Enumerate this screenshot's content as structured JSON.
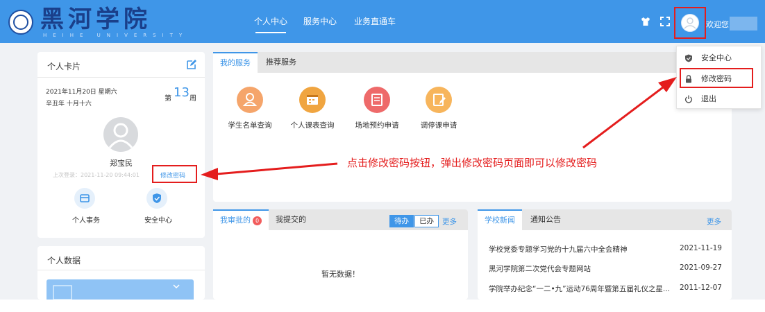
{
  "header": {
    "logo_text": "黑河学院",
    "logo_sub": "HEIHE UNIVERSITY",
    "nav": [
      "个人中心",
      "服务中心",
      "业务直通车"
    ],
    "welcome": "欢迎您"
  },
  "personal_card": {
    "title": "个人卡片",
    "date": "2021年11月20日 星期六",
    "lunar": "辛丑年 十月十六",
    "week_prefix": "第",
    "week_number": "13",
    "week_suffix": "周",
    "user_name": "郑宝民",
    "last_login": "上次登录：2021-11-20 09:44:01",
    "change_password": "修改密码",
    "quick_links": [
      "个人事务",
      "安全中心"
    ]
  },
  "personal_data": {
    "title": "个人数据"
  },
  "services": {
    "tabs": [
      "我的服务",
      "推荐服务"
    ],
    "items": [
      {
        "label": "学生名单查询",
        "icon": "user-icon",
        "color": "#f5a56b"
      },
      {
        "label": "个人课表查询",
        "icon": "calendar-icon",
        "color": "#f0a540"
      },
      {
        "label": "场地预约申请",
        "icon": "document-icon",
        "color": "#ee6a6a"
      },
      {
        "label": "调停课申请",
        "icon": "edit-icon",
        "color": "#f7b55c"
      }
    ]
  },
  "annotation": "点击修改密码按钮，弹出修改密码页面即可以修改密码",
  "approvals": {
    "tabs": [
      "我审批的",
      "我提交的"
    ],
    "badge": "0",
    "toggle": [
      "待办",
      "已办"
    ],
    "more": "更多",
    "empty": "暂无数据！"
  },
  "news": {
    "tabs": [
      "学校新闻",
      "通知公告"
    ],
    "more": "更多",
    "items": [
      {
        "title": "学校党委专题学习党的十九届六中全会精神",
        "date": "2021-11-19"
      },
      {
        "title": "黑河学院第二次党代会专题网站",
        "date": "2021-09-27"
      },
      {
        "title": "学院举办纪念“一二•九”运动76周年暨第五届礼仪之星...",
        "date": "2011-12-07"
      }
    ]
  },
  "dropdown": {
    "items": [
      {
        "label": "安全中心",
        "icon": "shield-icon"
      },
      {
        "label": "修改密码",
        "icon": "lock-icon"
      },
      {
        "label": "退出",
        "icon": "power-icon"
      }
    ]
  },
  "colors": {
    "primary": "#3f96e8",
    "annotation": "#e41d1d"
  }
}
